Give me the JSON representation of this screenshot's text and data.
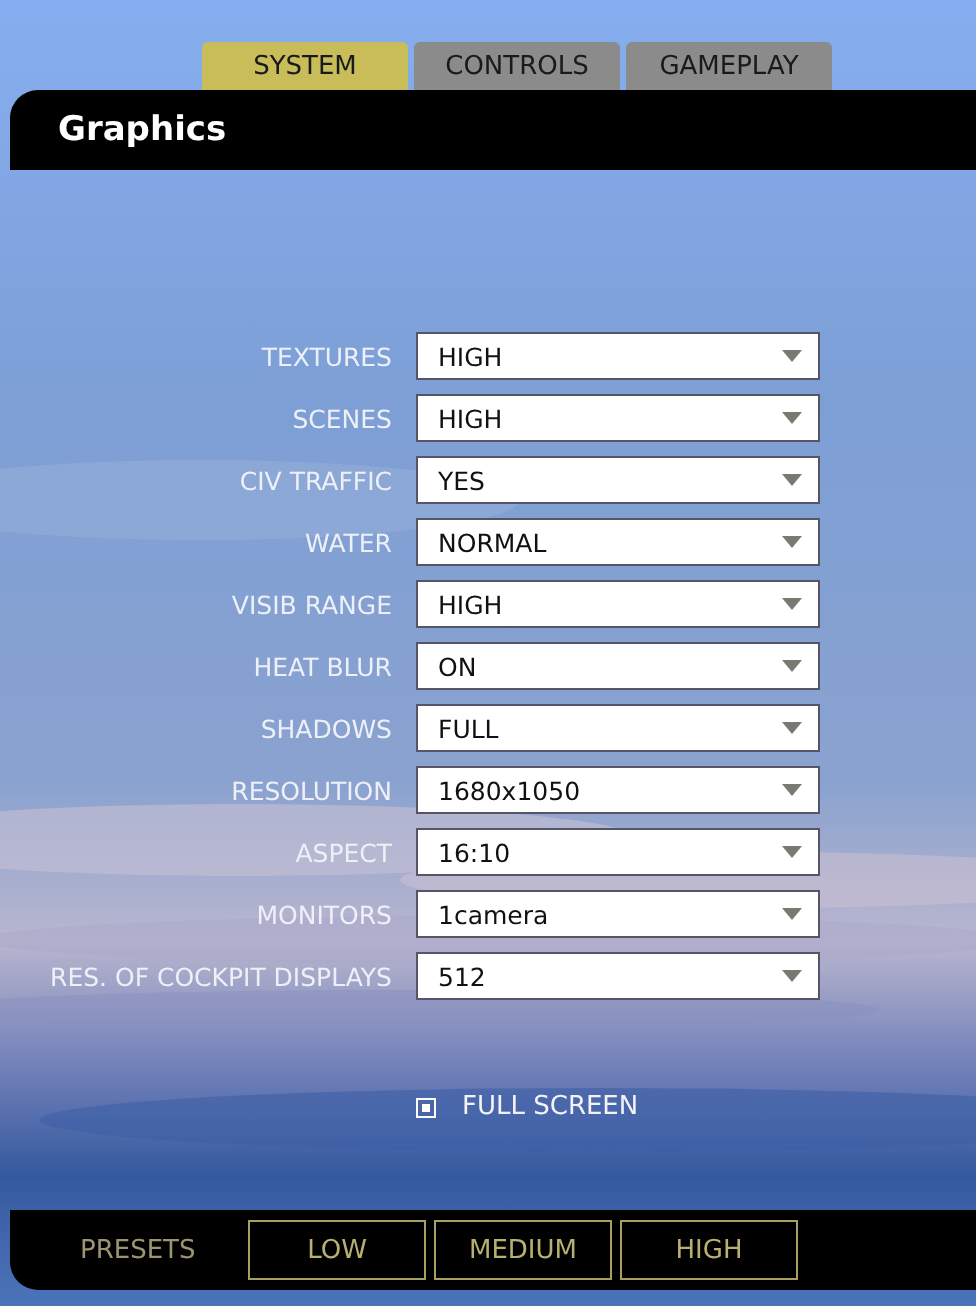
{
  "tabs": [
    {
      "label": "SYSTEM",
      "selected": true
    },
    {
      "label": "CONTROLS",
      "selected": false
    },
    {
      "label": "GAMEPLAY",
      "selected": false
    }
  ],
  "panel": {
    "title": "Graphics"
  },
  "settings": [
    {
      "label": "TEXTURES",
      "value": "HIGH"
    },
    {
      "label": "SCENES",
      "value": "HIGH"
    },
    {
      "label": "CIV TRAFFIC",
      "value": "YES"
    },
    {
      "label": "WATER",
      "value": "NORMAL"
    },
    {
      "label": "VISIB RANGE",
      "value": "HIGH"
    },
    {
      "label": "HEAT BLUR",
      "value": "ON"
    },
    {
      "label": "SHADOWS",
      "value": "FULL"
    },
    {
      "label": "RESOLUTION",
      "value": "1680x1050"
    },
    {
      "label": "ASPECT",
      "value": "16:10"
    },
    {
      "label": "MONITORS",
      "value": "1camera"
    },
    {
      "label": "RES. OF COCKPIT DISPLAYS",
      "value": "512"
    }
  ],
  "full_screen": {
    "label": "FULL SCREEN",
    "checked": true
  },
  "presets": {
    "label": "PRESETS",
    "buttons": [
      "LOW",
      "MEDIUM",
      "HIGH"
    ]
  }
}
